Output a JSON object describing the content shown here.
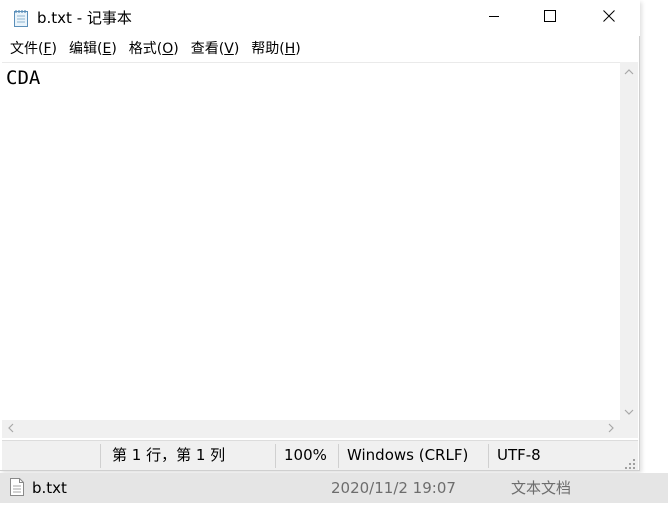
{
  "window": {
    "title": "b.txt - 记事本",
    "icons": {
      "app": "notepad-icon",
      "minimize": "minimize-icon",
      "maximize": "maximize-icon",
      "close": "close-icon"
    }
  },
  "menu": {
    "items": [
      {
        "label": "文件(",
        "key": "F",
        "suffix": ")"
      },
      {
        "label": "编辑(",
        "key": "E",
        "suffix": ")"
      },
      {
        "label": "格式(",
        "key": "O",
        "suffix": ")"
      },
      {
        "label": "查看(",
        "key": "V",
        "suffix": ")"
      },
      {
        "label": "帮助(",
        "key": "H",
        "suffix": ")"
      }
    ]
  },
  "editor": {
    "content": "CDA"
  },
  "statusbar": {
    "position": "第 1 行，第 1 列",
    "zoom": "100%",
    "line_ending": "Windows (CRLF)",
    "encoding": "UTF-8"
  },
  "explorer": {
    "file_name": "b.txt",
    "modified": "2020/11/2 19:07",
    "type": "文本文档",
    "icon": "text-file-icon"
  },
  "colors": {
    "statusbar_bg": "#f0f0f0",
    "explorer_row_bg": "#e5e5e5",
    "muted_text": "#6d6d6d"
  }
}
